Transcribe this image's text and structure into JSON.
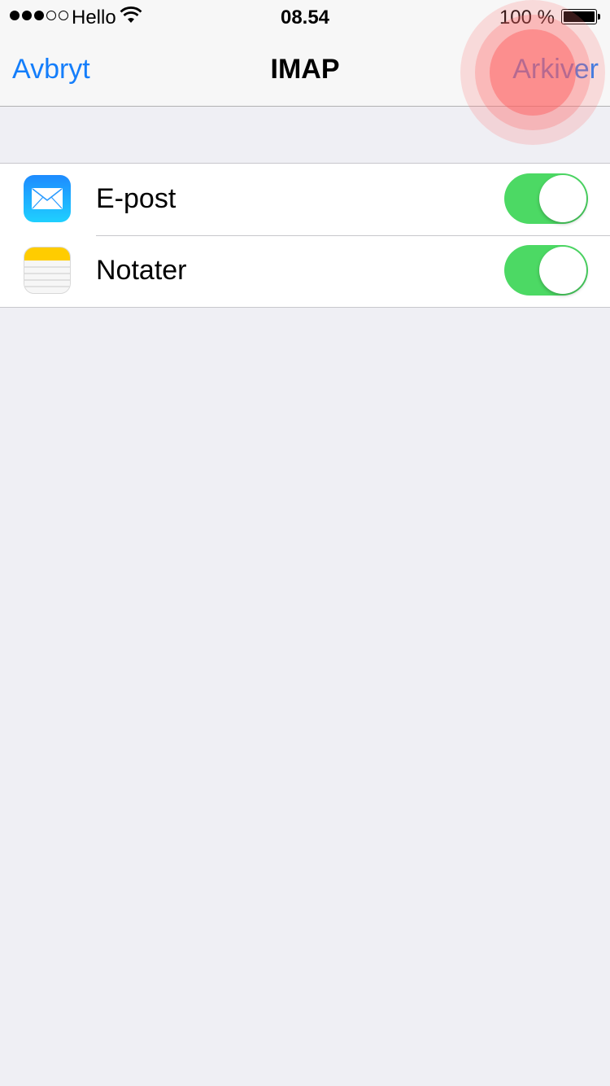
{
  "status_bar": {
    "carrier": "Hello",
    "time": "08.54",
    "battery_text": "100 %",
    "signal_bars_filled": 3,
    "signal_bars_total": 5,
    "battery_level": 1.0
  },
  "nav": {
    "left_label": "Avbryt",
    "title": "IMAP",
    "right_label": "Arkiver"
  },
  "rows": [
    {
      "label": "E-post",
      "icon": "mail-icon",
      "enabled": true
    },
    {
      "label": "Notater",
      "icon": "notes-icon",
      "enabled": true
    }
  ],
  "colors": {
    "accent": "#147efb",
    "toggle_on": "#4cd964",
    "background": "#efeff4"
  }
}
